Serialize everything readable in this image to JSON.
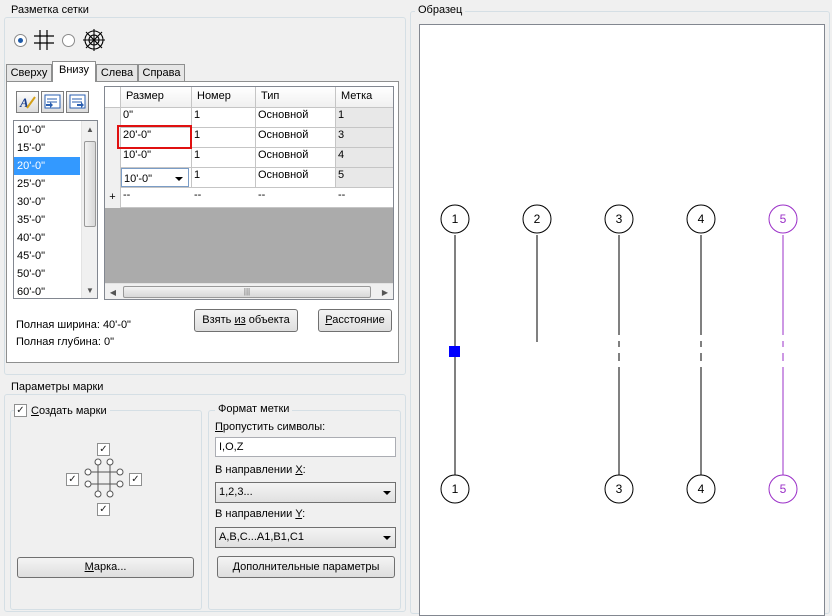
{
  "grid_layout": {
    "title": "Разметка сетки",
    "tabs": [
      "Сверху",
      "Внизу",
      "Слева",
      "Справа"
    ],
    "active_tab": "Внизу",
    "list_items": [
      "10'-0\"",
      "15'-0\"",
      "20'-0\"",
      "25'-0\"",
      "30'-0\"",
      "35'-0\"",
      "40'-0\"",
      "45'-0\"",
      "50'-0\"",
      "60'-0\""
    ],
    "selected_list_item": "20'-0\"",
    "table": {
      "columns": [
        "Размер",
        "Номер",
        "Тип",
        "Метка"
      ],
      "rows": [
        [
          "0\"",
          "1",
          "Основной",
          "1"
        ],
        [
          "20'-0\"",
          "1",
          "Основной",
          "3"
        ],
        [
          "10'-0\"",
          "1",
          "Основной",
          "4"
        ],
        [
          "10'-0\"",
          "1",
          "Основной",
          "5"
        ]
      ],
      "new_row_marker": "+",
      "new_row": [
        "--",
        "--",
        "--",
        "--"
      ]
    },
    "total_width": "Полная ширина: 40'-0\"",
    "total_depth": "Полная глубина: 0\"",
    "from_object_prefix": "Взять ",
    "from_object_u": "из",
    "from_object_suffix": " объекта",
    "distance_u": "Р",
    "distance_rest": "асстояние"
  },
  "marker_params": {
    "title": "Параметры марки",
    "create_markers_u": "С",
    "create_markers_rest": "оздать марки",
    "create_markers_checked": true,
    "marker_button_u": "М",
    "marker_button_rest": "арка..."
  },
  "label_format": {
    "title": "Формат метки",
    "skip_u": "П",
    "skip_rest": "ропустить символы:",
    "skip_value": "I,O,Z",
    "x_dir_prefix": "В направлении ",
    "x_dir_u": "X",
    "x_dir_suffix": ":",
    "x_value": "1,2,3...",
    "y_dir_prefix": "В направлении ",
    "y_dir_u": "Y",
    "y_dir_suffix": ":",
    "y_value": "A,B,C...A1,B1,C1",
    "more_u": "Д",
    "more_rest": "ополнительные параметры"
  },
  "preview": {
    "title": "Образец",
    "top_bubbles": [
      "1",
      "2",
      "3",
      "4",
      "5"
    ],
    "bottom_bubbles": [
      "1",
      "3",
      "4",
      "5"
    ],
    "line_color": "#000000",
    "highlight_color": "#9b30c8",
    "grip_color": "#0000ff"
  },
  "icons": {
    "radio_rect_grid": "rect-grid-icon",
    "radio_radial_grid": "radial-grid-icon",
    "toolbar": [
      "edit-icon",
      "import-icon",
      "export-icon"
    ]
  }
}
